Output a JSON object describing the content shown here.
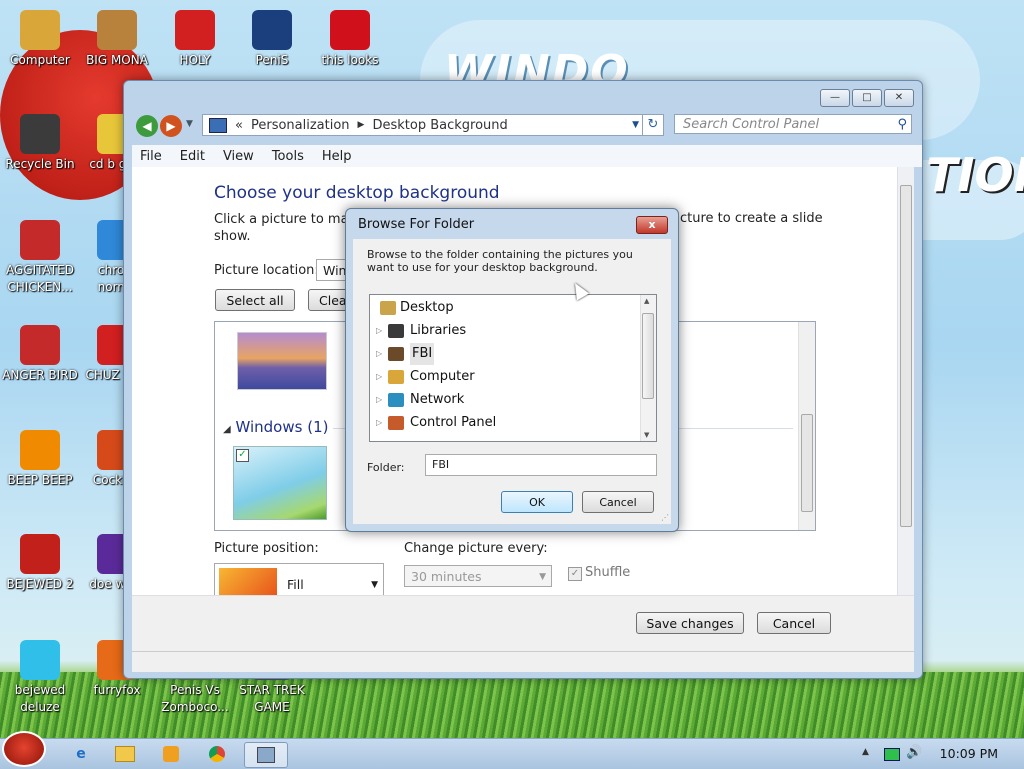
{
  "desktop": {
    "brand_text": "WINDO",
    "brand_text2": "TION",
    "icons": [
      {
        "label": "Computer",
        "icon": "computer-icon",
        "color": "#d9a63a"
      },
      {
        "label": "BIG MONA",
        "icon": "money-bag-icon",
        "color": "#b9823c"
      },
      {
        "label": "HOLY",
        "icon": "radiation-icon",
        "color": "#d21f1f"
      },
      {
        "label": "PeniS",
        "icon": "photoshop-icon",
        "color": "#1b3f7c"
      },
      {
        "label": "this looks",
        "icon": "opera-icon",
        "color": "#d0111b"
      },
      {
        "label": "Recycle Bin",
        "icon": "recycle-bin-icon",
        "color": "#3b3b3b"
      },
      {
        "label": "cd b gold",
        "icon": "angry-bird-icon",
        "color": "#e8c63a"
      },
      {
        "label": "AGGITATED CHICKEN...",
        "icon": "angry-bird-icon",
        "color": "#c52a2a"
      },
      {
        "label": "chrom norma",
        "icon": "chrome-icon",
        "color": "#2f88d8"
      },
      {
        "label": "ANGER BIRD",
        "icon": "angry-bird-icon",
        "color": "#c52a2a"
      },
      {
        "label": "CHUZ MY J",
        "icon": "red-ball-icon",
        "color": "#d21f1f"
      },
      {
        "label": "BEEP BEEP",
        "icon": "vlc-icon",
        "color": "#f08a00"
      },
      {
        "label": "CockClo",
        "icon": "app-icon",
        "color": "#d64a1a"
      },
      {
        "label": "BEJEWED 2",
        "icon": "bejeweled-icon",
        "color": "#c2201b"
      },
      {
        "label": "doe work",
        "icon": "yahoo-icon",
        "color": "#5b2a9a"
      },
      {
        "label": "bejewed deluze",
        "icon": "gem-icon",
        "color": "#2fbfe8"
      },
      {
        "label": "furryfox",
        "icon": "firefox-icon",
        "color": "#e66a17"
      },
      {
        "label": "Penis Vs Zomboco...",
        "icon": "game-icon",
        "color": "#5a8a2a"
      },
      {
        "label": "STAR TREK GAME",
        "icon": "game-icon",
        "color": "#555555"
      }
    ]
  },
  "window": {
    "breadcrumb": [
      "Personalization",
      "Desktop Background"
    ],
    "search_placeholder": "Search Control Panel",
    "menu": [
      "File",
      "Edit",
      "View",
      "Tools",
      "Help"
    ],
    "heading": "Choose your desktop background",
    "description": "Click a picture to make",
    "description_right": "cture to create a slide",
    "description_line2": "show.",
    "picture_location_label": "Picture location:",
    "picture_location_value": "Winc",
    "select_all": "Select all",
    "clear_all": "Clea",
    "group_label": "Windows (1)",
    "picture_position_label": "Picture position:",
    "picture_position_value": "Fill",
    "change_every_label": "Change picture every:",
    "change_every_value": "30 minutes",
    "shuffle_label": "Shuffle",
    "save_button": "Save changes",
    "cancel_button": "Cancel"
  },
  "dialog": {
    "title": "Browse For Folder",
    "close": "x",
    "description": "Browse to the folder containing the pictures you want to use for your desktop background.",
    "tree": [
      {
        "label": "Desktop",
        "icon": "desktop-folder-icon",
        "color": "#c9a44a"
      },
      {
        "label": "Libraries",
        "icon": "libraries-icon",
        "color": "#3a3a3a"
      },
      {
        "label": "FBI",
        "icon": "user-folder-icon",
        "color": "#6b4a2a"
      },
      {
        "label": "Computer",
        "icon": "computer-icon",
        "color": "#d9a63a"
      },
      {
        "label": "Network",
        "icon": "network-icon",
        "color": "#2a8fbf"
      },
      {
        "label": "Control Panel",
        "icon": "control-panel-icon",
        "color": "#c55a2a"
      }
    ],
    "folder_label": "Folder:",
    "folder_value": "FBI",
    "ok_button": "OK",
    "cancel_button": "Cancel"
  },
  "taskbar": {
    "clock": "10:09 PM",
    "items": [
      "ie-icon",
      "explorer-icon",
      "media-player-icon",
      "chrome-icon",
      "personalization-icon"
    ]
  }
}
